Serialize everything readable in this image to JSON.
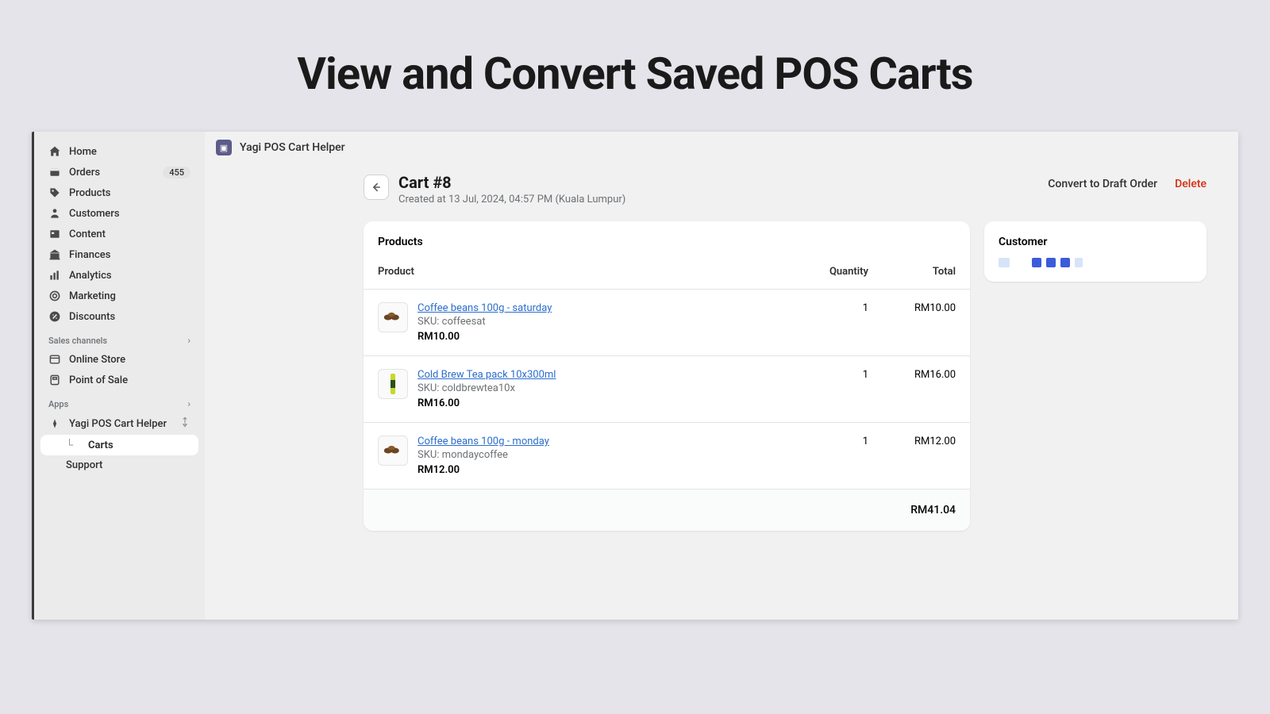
{
  "page_heading": "View and Convert Saved POS Carts",
  "app_name": "Yagi POS Cart Helper",
  "sidebar": {
    "items": [
      {
        "label": "Home",
        "icon": "home"
      },
      {
        "label": "Orders",
        "icon": "orders",
        "badge": "455"
      },
      {
        "label": "Products",
        "icon": "products"
      },
      {
        "label": "Customers",
        "icon": "customers"
      },
      {
        "label": "Content",
        "icon": "content"
      },
      {
        "label": "Finances",
        "icon": "finances"
      },
      {
        "label": "Analytics",
        "icon": "analytics"
      },
      {
        "label": "Marketing",
        "icon": "marketing"
      },
      {
        "label": "Discounts",
        "icon": "discounts"
      }
    ],
    "sales_section": "Sales channels",
    "sales_items": [
      {
        "label": "Online Store"
      },
      {
        "label": "Point of Sale"
      }
    ],
    "apps_section": "Apps",
    "app_item": "Yagi POS Cart Helper",
    "app_subitems": [
      {
        "label": "Carts",
        "active": true
      },
      {
        "label": "Support"
      }
    ]
  },
  "cart": {
    "title": "Cart #8",
    "subtitle": "Created at 13 Jul, 2024, 04:57 PM (Kuala Lumpur)",
    "convert_label": "Convert to Draft Order",
    "delete_label": "Delete"
  },
  "products_card": {
    "title": "Products",
    "headers": {
      "product": "Product",
      "qty": "Quantity",
      "total": "Total"
    },
    "rows": [
      {
        "name": "Coffee beans 100g - saturday",
        "sku": "SKU: coffeesat",
        "price": "RM10.00",
        "qty": "1",
        "total": "RM10.00",
        "thumb": "beans"
      },
      {
        "name": "Cold Brew Tea pack 10x300ml",
        "sku": "SKU: coldbrewtea10x",
        "price": "RM16.00",
        "qty": "1",
        "total": "RM16.00",
        "thumb": "bottle"
      },
      {
        "name": "Coffee beans 100g - monday",
        "sku": "SKU: mondaycoffee",
        "price": "RM12.00",
        "qty": "1",
        "total": "RM12.00",
        "thumb": "beans"
      }
    ],
    "grand_total": "RM41.04"
  },
  "customer_card": {
    "title": "Customer"
  }
}
